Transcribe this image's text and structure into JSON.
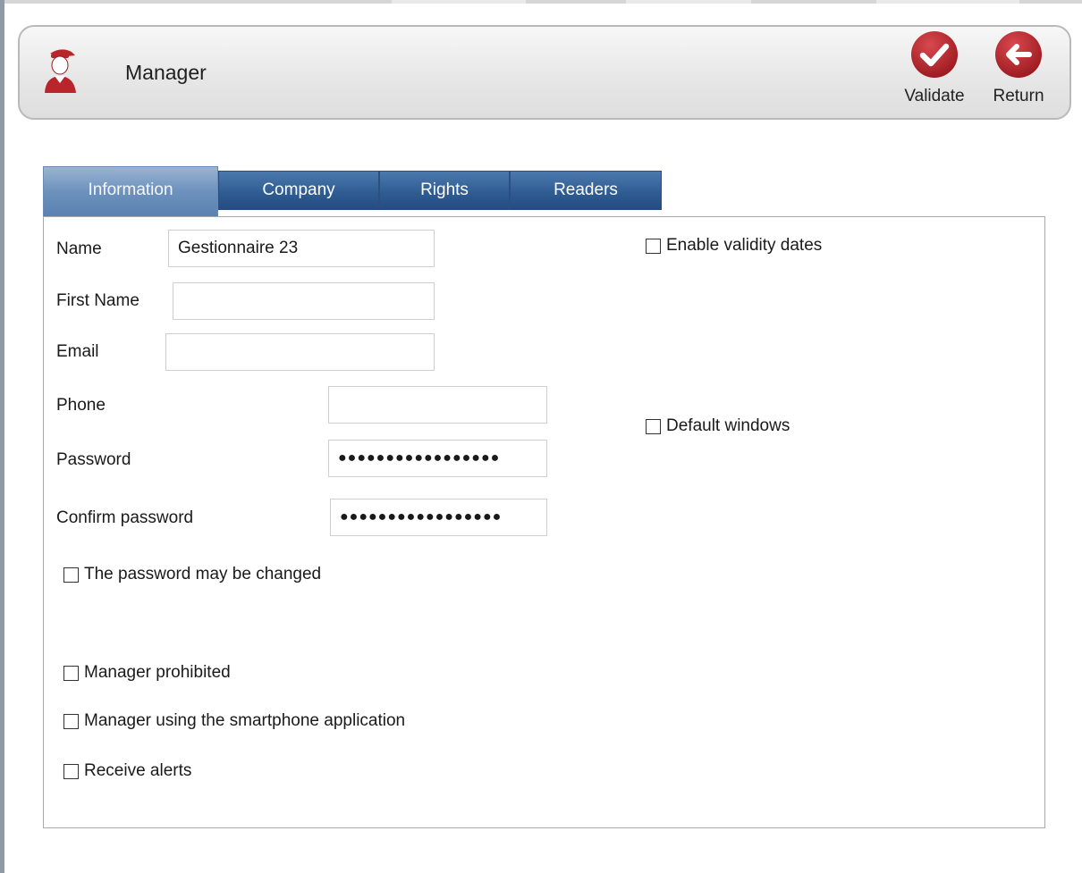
{
  "header": {
    "title": "Manager",
    "validate_label": "Validate",
    "return_label": "Return",
    "accent_color": "#b8262c"
  },
  "icons": {
    "user": "user-icon",
    "validate": "checkmark-icon",
    "return": "arrow-left-icon"
  },
  "tabs": [
    {
      "label": "Information",
      "active": true
    },
    {
      "label": "Company",
      "active": false
    },
    {
      "label": "Rights",
      "active": false
    },
    {
      "label": "Readers",
      "active": false
    }
  ],
  "form": {
    "name": {
      "label": "Name",
      "value": "Gestionnaire 23"
    },
    "first_name": {
      "label": "First Name",
      "value": ""
    },
    "email": {
      "label": "Email",
      "value": ""
    },
    "phone": {
      "label": "Phone",
      "value": ""
    },
    "password": {
      "label": "Password",
      "value": "●●●●●●●●●●●●●●●●●"
    },
    "confirm_password": {
      "label": "Confirm password",
      "value": "●●●●●●●●●●●●●●●●●"
    },
    "password_may_change": {
      "label": "The password may be changed",
      "checked": false
    },
    "manager_prohibited": {
      "label": "Manager prohibited",
      "checked": false
    },
    "smartphone_app": {
      "label": "Manager using the smartphone application",
      "checked": false
    },
    "receive_alerts": {
      "label": "Receive alerts",
      "checked": false
    },
    "enable_validity_dates": {
      "label": "Enable validity dates",
      "checked": false
    },
    "default_windows": {
      "label": "Default windows",
      "checked": false
    }
  }
}
